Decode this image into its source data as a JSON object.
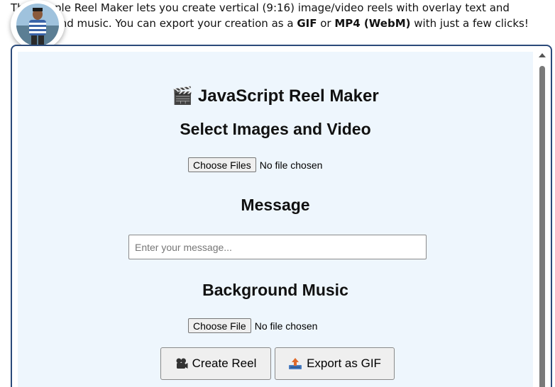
{
  "intro": {
    "text_1": "This simple Reel Maker lets you create vertical (9:16) image/video reels with overlay text and background music. You can export your creation as a ",
    "format_gif": "GIF",
    "text_2": " or ",
    "format_mp4": "MP4 (WebM)",
    "text_3": " with just a few clicks!"
  },
  "app": {
    "title_icon": "🎬",
    "title": "JavaScript Reel Maker"
  },
  "images": {
    "heading": "Select Images and Video",
    "button_label": "Choose Files",
    "status": "No file chosen"
  },
  "message": {
    "heading": "Message",
    "placeholder": "Enter your message..."
  },
  "music": {
    "heading": "Background Music",
    "button_label": "Choose File",
    "status": "No file chosen"
  },
  "actions": {
    "create_label": "Create Reel",
    "create_icon": "film-projector-icon",
    "export_label": "Export as GIF",
    "export_icon": "export-tray-icon"
  },
  "colors": {
    "panel_background": "#eef6fd",
    "frame_border": "#2b4a7a"
  }
}
